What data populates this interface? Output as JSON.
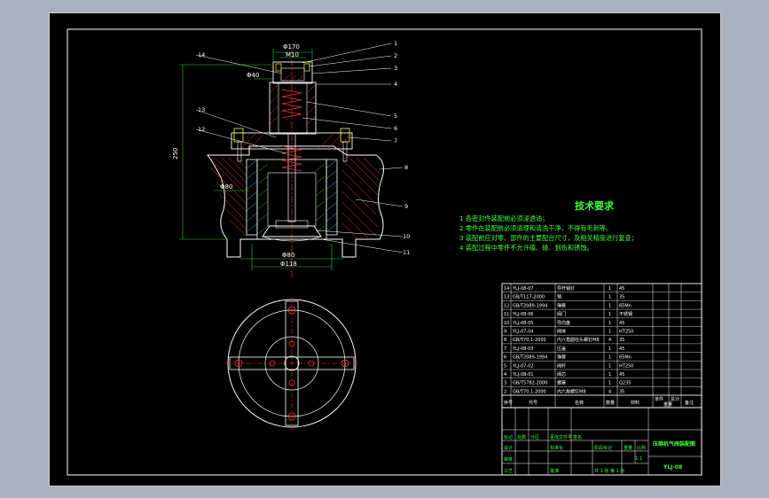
{
  "drawing": {
    "tech_requirements": {
      "title": "技术要求",
      "items": [
        "1 各密封件装配前必须浸透油；",
        "2 零件在装配前必须清理和清洗干净，不得有毛刺等。",
        "3 装配前应对零、部件的主要配合尺寸，及相关精度进行复查；",
        "4 装配过程中零件不允许磕、碰、划伤和锈蚀。"
      ]
    },
    "dimensions": {
      "top_outer": "Φ170",
      "top_inner": "M10",
      "left_small": "Φ40",
      "height": "250",
      "mid_left": "Φ80",
      "bottom_inner": "Φ80",
      "bottom_outer": "Φ118"
    },
    "callouts_left": [
      "14",
      "13",
      "12"
    ],
    "callouts_right": [
      "1",
      "2",
      "3",
      "4",
      "5",
      "6",
      "7",
      "8",
      "9",
      "10",
      "11"
    ],
    "parts_list": {
      "rows": [
        {
          "no": "14",
          "code": "YLJ-08-07",
          "name": "导杆销钉",
          "qty": "1",
          "mat": "45"
        },
        {
          "no": "13",
          "code": "GB/T117-2000",
          "name": "销",
          "qty": "1",
          "mat": "35"
        },
        {
          "no": "12",
          "code": "GB/T2089-1994",
          "name": "弹簧",
          "qty": "1",
          "mat": "65Mn"
        },
        {
          "no": "11",
          "code": "YLJ-08-06",
          "name": "阀门",
          "qty": "1",
          "mat": "不锈钢"
        },
        {
          "no": "10",
          "code": "YLJ-08-05",
          "name": "导向盘",
          "qty": "1",
          "mat": "45"
        },
        {
          "no": "9",
          "code": "YLJ-07-04",
          "name": "阀体",
          "qty": "1",
          "mat": "HT250"
        },
        {
          "no": "8",
          "code": "GB/T70.1-2000",
          "name": "内六角圆柱头螺钉M8",
          "qty": "4",
          "mat": "35"
        },
        {
          "no": "7",
          "code": "YLJ-08-03",
          "name": "压盖",
          "qty": "1",
          "mat": "45"
        },
        {
          "no": "6",
          "code": "GB/T2089-1994",
          "name": "弹簧",
          "qty": "1",
          "mat": "65Mn"
        },
        {
          "no": "5",
          "code": "YLJ-07-02",
          "name": "阀杆",
          "qty": "1",
          "mat": "HT250"
        },
        {
          "no": "4",
          "code": "YLJ-08-01",
          "name": "阀芯",
          "qty": "1",
          "mat": "45"
        },
        {
          "no": "3",
          "code": "GB/T5782-2000",
          "name": "螺塞",
          "qty": "1",
          "mat": "Q235"
        },
        {
          "no": "2",
          "code": "GB/T70.1-2000",
          "name": "内六角螺钉M8",
          "qty": "4",
          "mat": "35"
        }
      ],
      "header": {
        "no": "序号",
        "code": "代号",
        "name": "名称",
        "qty": "数量",
        "mat": "材料",
        "unit_w": "单件",
        "total_w": "总计",
        "w": "重量",
        "note": "备注"
      }
    },
    "title_block": {
      "drawing_name": "压缩机气阀装配图",
      "drawing_no": "YLJ-08",
      "scale": "1:1",
      "sheet": "共 1 张  第 1 张",
      "labels": [
        "标记",
        "处数",
        "分区",
        "更改文件号",
        "签名",
        "年月日",
        "设计",
        "标准化",
        "审核",
        "工艺",
        "批准",
        "阶段标记",
        "重量",
        "比例"
      ]
    }
  }
}
